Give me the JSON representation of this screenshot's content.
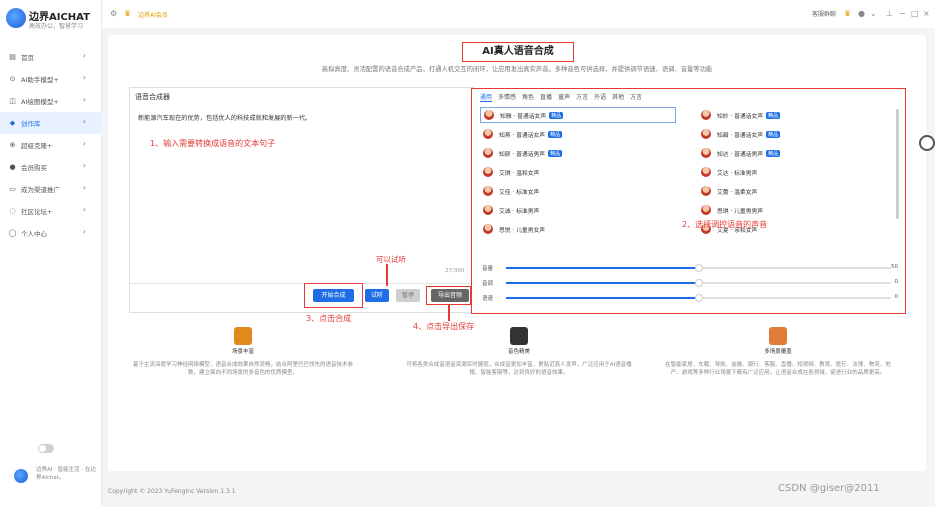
{
  "app": {
    "title": "边界AICHAT",
    "subtitle": "高效办公，智慧学习"
  },
  "topbar": {
    "notice": "边界AI会员",
    "right_label": "客服群聊"
  },
  "nav": [
    {
      "label": "首页",
      "icon": "home-icon"
    },
    {
      "label": "AI助手模型+",
      "icon": "bot-icon"
    },
    {
      "label": "AI绘图模型+",
      "icon": "paint-icon"
    },
    {
      "label": "创作库",
      "icon": "diamond-icon",
      "active": true
    },
    {
      "label": "超级克隆+",
      "icon": "plus-icon"
    },
    {
      "label": "会员购买",
      "icon": "user-icon"
    },
    {
      "label": "成为渠道推广",
      "icon": "share-icon"
    },
    {
      "label": "社区论坛+",
      "icon": "chat-icon"
    },
    {
      "label": "个人中心",
      "icon": "person-icon"
    }
  ],
  "bottom_brand": "边界AI · 智能生活 · 在边界AIchat。",
  "page": {
    "title": "AI真人语音合成",
    "subtitle": "高拟真度、灵活配置的语音合成产品，打通人机交互的闭环，让应用发出真实声音。多种音色可供选择，并提供调节语速、语调、音量等功能"
  },
  "editor": {
    "title": "语音合成器",
    "text": "新能源汽车现在的优势，包括优人的科技成就和发展的新一代。",
    "hint": "1、输入需要转换成语音的文本句子",
    "counter": "27/300"
  },
  "voice_panel": {
    "tabs": [
      "通用",
      "多情感",
      "角色",
      "直播",
      "童声",
      "方言",
      "外语",
      "其他",
      "方言"
    ],
    "hint": "2、选择调控语音的声音",
    "badge": "精品",
    "voices_left": [
      {
        "name": "知雅 · 普通话女声",
        "badge": true,
        "selected": true
      },
      {
        "name": "知燕 · 普通话女声",
        "badge": true
      },
      {
        "name": "知颜 · 普通话男声",
        "badge": true
      },
      {
        "name": "艾琪 · 温和女声",
        "badge": false
      },
      {
        "name": "艾佳 · 标准女声",
        "badge": false
      },
      {
        "name": "艾诚 · 标准男声",
        "badge": false
      },
      {
        "name": "思悦 · 儿童男女声",
        "badge": false
      }
    ],
    "voices_right": [
      {
        "name": "知妙 · 普通话女声",
        "badge": true
      },
      {
        "name": "知甜 · 普通话女声",
        "badge": true
      },
      {
        "name": "知达 · 普通话男声",
        "badge": true
      },
      {
        "name": "艾达 · 标准男声",
        "badge": false
      },
      {
        "name": "艾蕾 · 温柔女声",
        "badge": false
      },
      {
        "name": "思琪 · 儿童男男声",
        "badge": false
      },
      {
        "name": "艾夏 · 亲和女声",
        "badge": false
      }
    ],
    "sliders": [
      {
        "label": "音量",
        "value": "50",
        "fraction": 0.5
      },
      {
        "label": "音调",
        "value": "0",
        "fraction": 0.5
      },
      {
        "label": "语速",
        "value": "0",
        "fraction": 0.5
      }
    ]
  },
  "buttons": {
    "synthesize": "开始合成",
    "listen": "试听",
    "pause": "暂停",
    "export": "导出音频",
    "hint_listen": "可以试听",
    "hint_synth": "3、点击合成",
    "hint_export": "4、点击导出保存"
  },
  "features": [
    {
      "name": "场景丰富",
      "desc": "基于主流深度学习神经网络模型，语音合成效果自然流畅，结合阿里巴巴领先的语音技术参数，建立面向不同场景的多音色的优质模型。",
      "icon": "cube-icon",
      "color": "#e08a1e"
    },
    {
      "name": "音色精美",
      "desc": "可将各类合成音语音资源实时展现，合成音更加丰富，更贴近真人发声，广泛应用于AI语音播报、智能客服等，达到良好的语音效果。",
      "icon": "logo-icon",
      "color": "#333333"
    },
    {
      "name": "多场景覆盖",
      "desc": "在智能家居、车载、导航、金融、银行、客服、直播、短视频、教育、医疗、法律、物流、地产、游戏等多种行业场景下都有广泛应用，让语音合成在各领域，促进行业的品质更高。",
      "icon": "house-icon",
      "color": "#e07b3a"
    }
  ],
  "footer": "Copyright © 2023 YuFengInc Version 1.3.1",
  "watermark": "CSDN @giser@2011",
  "colors": {
    "accent": "#1e6fe6",
    "annotation": "#e53935"
  }
}
